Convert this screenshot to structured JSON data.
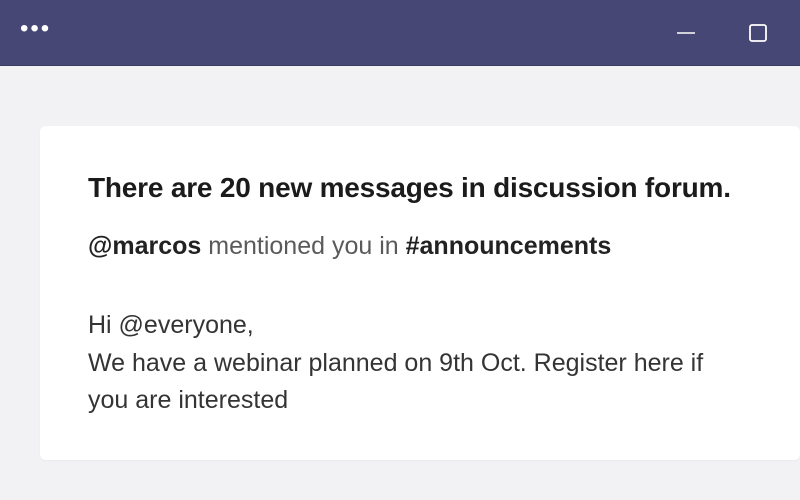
{
  "titlebar": {
    "overflow_label": "•••"
  },
  "card": {
    "heading": "There are 20 new messages in discussion forum.",
    "mention_user": "@marcos",
    "mention_middle": " mentioned you in ",
    "mention_channel": "#announcements",
    "body": "Hi @everyone,\nWe have a webinar planned on 9th Oct. Register here if you are interested"
  }
}
